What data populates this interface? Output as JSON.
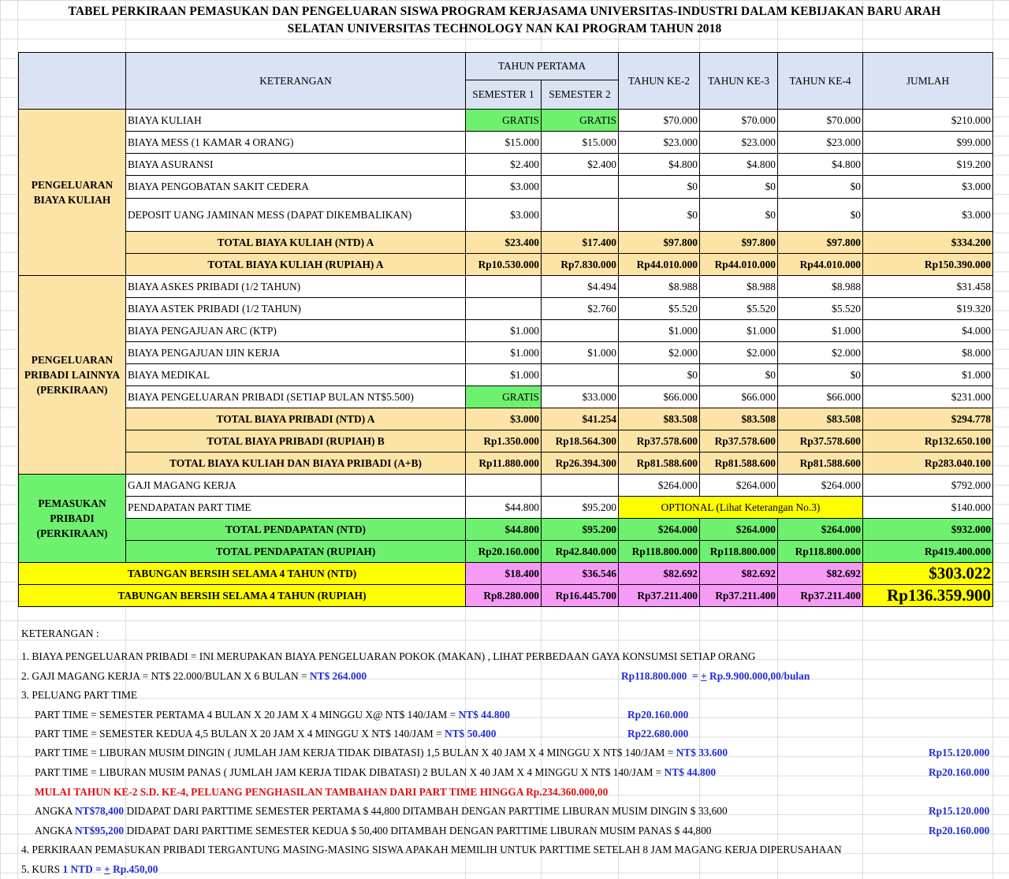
{
  "title": {
    "line1": "TABEL PERKIRAAN PEMASUKAN DAN PENGELUARAN SISWA PROGRAM KERJASAMA  UNIVERSITAS-INDUSTRI  DALAM KEBIJAKAN BARU ARAH",
    "line2": "SELATAN UNIVERSITAS TECHNOLOGY  NAN KAI  PROGRAM TAHUN 2018"
  },
  "header": {
    "keterangan": "KETERANGAN",
    "tahun_pertama": "TAHUN PERTAMA",
    "semester1": "SEMESTER 1",
    "semester2": "SEMESTER 2",
    "tahun2": "TAHUN KE-2",
    "tahun3": "TAHUN KE-3",
    "tahun4": "TAHUN KE-4",
    "jumlah": "JUMLAH"
  },
  "groups": {
    "kuliah": "PENGELUARAN BIAYA KULIAH",
    "pribadi": "PENGELUARAN PRIBADI LAINNYA (PERKIRAAN)",
    "pemasukan": "PEMASUKAN PRIBADI (PERKIRAAN)"
  },
  "rows": [
    {
      "label": "BIAYA KULIAH",
      "cells": [
        "GRATIS",
        "GRATIS",
        "$70.000",
        "$70.000",
        "$70.000",
        "$210.000"
      ]
    },
    {
      "label": "BIAYA  MESS (1 KAMAR 4 ORANG)",
      "cells": [
        "$15.000",
        "$15.000",
        "$23.000",
        "$23.000",
        "$23.000",
        "$99.000"
      ]
    },
    {
      "label": "BIAYA ASURANSI",
      "cells": [
        "$2.400",
        "$2.400",
        "$4.800",
        "$4.800",
        "$4.800",
        "$19.200"
      ]
    },
    {
      "label": "BIAYA PENGOBATAN SAKIT CEDERA",
      "cells": [
        "$3.000",
        "",
        "$0",
        "$0",
        "$0",
        "$3.000"
      ]
    },
    {
      "label": "DEPOSIT UANG JAMINAN MESS (DAPAT DIKEMBALIKAN)",
      "cells": [
        "$3.000",
        "",
        "$0",
        "$0",
        "$0",
        "$3.000"
      ]
    },
    {
      "label": "TOTAL BIAYA KULIAH (NTD) A",
      "cells": [
        "$23.400",
        "$17.400",
        "$97.800",
        "$97.800",
        "$97.800",
        "$334.200"
      ]
    },
    {
      "label": "TOTAL BIAYA KULIAH (RUPIAH) A",
      "cells": [
        "Rp10.530.000",
        "Rp7.830.000",
        "Rp44.010.000",
        "Rp44.010.000",
        "Rp44.010.000",
        "Rp150.390.000"
      ]
    },
    {
      "label": "BIAYA ASKES PRIBADI (1/2 TAHUN)",
      "cells": [
        "",
        "$4.494",
        "$8.988",
        "$8.988",
        "$8.988",
        "$31.458"
      ]
    },
    {
      "label": "BIAYA ASTEK  PRIBADI (1/2 TAHUN)",
      "cells": [
        "",
        "$2.760",
        "$5.520",
        "$5.520",
        "$5.520",
        "$19.320"
      ]
    },
    {
      "label": "BIAYA PENGAJUAN ARC (KTP)",
      "cells": [
        "$1.000",
        "",
        "$1.000",
        "$1.000",
        "$1.000",
        "$4.000"
      ]
    },
    {
      "label": "BIAYA PENGAJUAN IJIN KERJA",
      "cells": [
        "$1.000",
        "$1.000",
        "$2.000",
        "$2.000",
        "$2.000",
        "$8.000"
      ]
    },
    {
      "label": "BIAYA MEDIKAL",
      "cells": [
        "$1.000",
        "",
        "$0",
        "$0",
        "$0",
        "$1.000"
      ]
    },
    {
      "label": "BIAYA PENGELUARAN PRIBADI (SETIAP BULAN NT$5.500)",
      "cells": [
        "GRATIS",
        "$33.000",
        "$66.000",
        "$66.000",
        "$66.000",
        "$231.000"
      ]
    },
    {
      "label": "TOTAL BIAYA PRIBADI  (NTD) A",
      "cells": [
        "$3.000",
        "$41.254",
        "$83.508",
        "$83.508",
        "$83.508",
        "$294.778"
      ]
    },
    {
      "label": "TOTAL BIAYA PRIBADI (RUPIAH) B",
      "cells": [
        "Rp1.350.000",
        "Rp18.564.300",
        "Rp37.578.600",
        "Rp37.578.600",
        "Rp37.578.600",
        "Rp132.650.100"
      ]
    },
    {
      "label": "TOTAL BIAYA KULIAH DAN BIAYA PRIBADI (A+B)",
      "cells": [
        "Rp11.880.000",
        "Rp26.394.300",
        "Rp81.588.600",
        "Rp81.588.600",
        "Rp81.588.600",
        "Rp283.040.100"
      ]
    },
    {
      "label": "GAJI MAGANG KERJA",
      "cells": [
        "",
        "",
        "$264.000",
        "$264.000",
        "$264.000",
        "$792.000"
      ]
    },
    {
      "label": "PENDAPATAN PART TIME",
      "cells": [
        "$44.800",
        "$95.200",
        "OPTIONAL (Lihat Keterangan No.3)",
        "$140.000"
      ]
    },
    {
      "label": "TOTAL PENDAPATAN  (NTD)",
      "cells": [
        "$44.800",
        "$95.200",
        "$264.000",
        "$264.000",
        "$264.000",
        "$932.000"
      ]
    },
    {
      "label": "TOTAL PENDAPATAN  (RUPIAH)",
      "cells": [
        "Rp20.160.000",
        "Rp42.840.000",
        "Rp118.800.000",
        "Rp118.800.000",
        "Rp118.800.000",
        "Rp419.400.000"
      ]
    },
    {
      "label": "TABUNGAN BERSIH SELAMA 4 TAHUN (NTD)",
      "cells": [
        "$18.400",
        "$36.546",
        "$82.692",
        "$82.692",
        "$82.692",
        "$303.022"
      ]
    },
    {
      "label": "TABUNGAN BERSIH SELAMA 4 TAHUN (RUPIAH)",
      "cells": [
        "Rp8.280.000",
        "Rp16.445.700",
        "Rp37.211.400",
        "Rp37.211.400",
        "Rp37.211.400",
        "Rp136.359.900"
      ]
    }
  ],
  "notes": {
    "heading": "KETERANGAN :",
    "n1": "1. BIAYA PENGELUARAN PRIBADI =  INI MERUPAKAN BIAYA PENGELUARAN POKOK (MAKAN) , LIHAT PERBEDAAN GAYA KONSUMSI SETIAP ORANG",
    "n2_text": "2. GAJI MAGANG KERJA = NT$ 22.000/BULAN X 6 BULAN = ",
    "n2_val": "NT$ 264.000",
    "n2_rp": "Rp118.800.000",
    "n2_eq": "= ",
    "n2_pm": "+",
    "n2_month": " Rp.9.900.000,00/bulan",
    "n3": "3. PELUANG PART TIME",
    "p1_text": "PART TIME = SEMESTER PERTAMA    4 BULAN X 20 JAM X 4 MINGGU X@ NT$ 140/JAM = ",
    "p1_val": "NT$ 44.800",
    "p1_rp": "Rp20.160.000",
    "p2_text": "PART TIME = SEMESTER KEDUA  4,5 BULAN X 20 JAM X 4 MINGGU X NT$ 140/JAM = ",
    "p2_val": "NT$ 50.400",
    "p2_rp": "Rp22.680.000",
    "p3_text": "PART TIME = LIBURAN MUSIM DINGIN ( JUMLAH JAM KERJA TIDAK DIBATASI) 1,5 BULAN X 40 JAM X 4 MINGGU X NT$ 140/JAM = ",
    "p3_val": "NT$ 33.600",
    "p3_rp": "Rp15.120.000",
    "p4_text": "PART TIME = LIBURAN MUSIM PANAS ( JUMLAH JAM KERJA TIDAK DIBATASI) 2 BULAN X 40 JAM X 4 MINGGU X NT$ 140/JAM = ",
    "p4_val": "NT$ 44.800",
    "p4_rp": "Rp20.160.000",
    "red": "MULAI TAHUN KE-2 S.D. KE-4, PELUANG PENGHASILAN TAMBAHAN DARI PART TIME  HINGGA Rp.234.360.000,00",
    "a1_pre": "ANGKA ",
    "a1_val": "NT$78,400",
    "a1_text": " DIDAPAT DARI PARTTIME SEMESTER PERTAMA $ 44,800 DITAMBAH DENGAN PARTTIME LIBURAN MUSIM DINGIN $ 33,600",
    "a1_rp": "Rp15.120.000",
    "a2_pre": "ANGKA ",
    "a2_val": "NT$95,200",
    "a2_text": " DIDAPAT DARI PARTTIME SEMESTER KEDUA $ 50,400 DITAMBAH DENGAN PARTTIME LIBURAN MUSIM PANAS $ 44,800",
    "a2_rp": "Rp20.160.000",
    "n4": "4. PERKIRAAN PEMASUKAN PRIBADI TERGANTUNG MASING-MASING SISWA APAKAH MEMILIH UNTUK PARTTIME SETELAH 8 JAM MAGANG KERJA DIPERUSAHAAN",
    "n5_text": "5. KURS ",
    "n5_val": "1 NTD = ",
    "n5_pm": "+",
    "n5_rate": " Rp.450,00"
  },
  "colors": {
    "header": "#dae3f3",
    "orange": "#fce4a6",
    "green": "#6ef16e",
    "yellow": "#fefe00",
    "pink": "#f59af5",
    "blue_text": "#1f2fd6",
    "red_text": "#e01010"
  }
}
